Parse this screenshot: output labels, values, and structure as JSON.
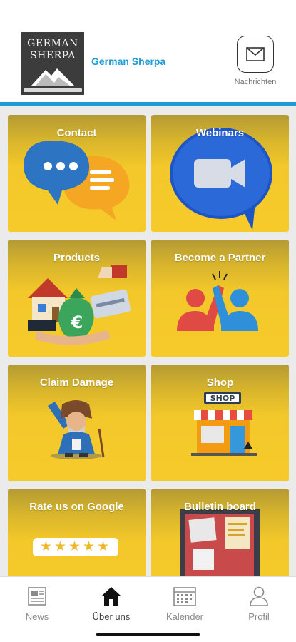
{
  "header": {
    "logo_line1": "GERMAN",
    "logo_line2": "SHERPA",
    "brand_name": "German Sherpa",
    "messages_label": "Nachrichten"
  },
  "icons": {
    "messages": "envelope-icon",
    "news": "newspaper-icon",
    "about": "house-icon",
    "calendar": "calendar-icon",
    "profile": "person-icon"
  },
  "tiles": [
    {
      "label": "Contact",
      "art": "chat-bubbles-illustration"
    },
    {
      "label": "Webinars",
      "art": "video-camera-bubble-illustration"
    },
    {
      "label": "Products",
      "art": "house-money-hand-illustration"
    },
    {
      "label": "Become a Partner",
      "art": "high-five-illustration"
    },
    {
      "label": "Claim Damage",
      "art": "sherpa-mascot-illustration"
    },
    {
      "label": "Shop",
      "art": "storefront-illustration"
    },
    {
      "label": "Rate us on Google",
      "stars": "★★★★★"
    },
    {
      "label": "Bulletin board",
      "art": "corkboard-illustration"
    }
  ],
  "tabbar": {
    "items": [
      {
        "label": "News",
        "active": false
      },
      {
        "label": "Über uns",
        "active": true
      },
      {
        "label": "Kalender",
        "active": false
      },
      {
        "label": "Profil",
        "active": false
      }
    ]
  },
  "colors": {
    "accent_blue": "#1d9bd7",
    "tile_yellow": "#f6ca2a",
    "grid_background": "#ebebeb"
  }
}
